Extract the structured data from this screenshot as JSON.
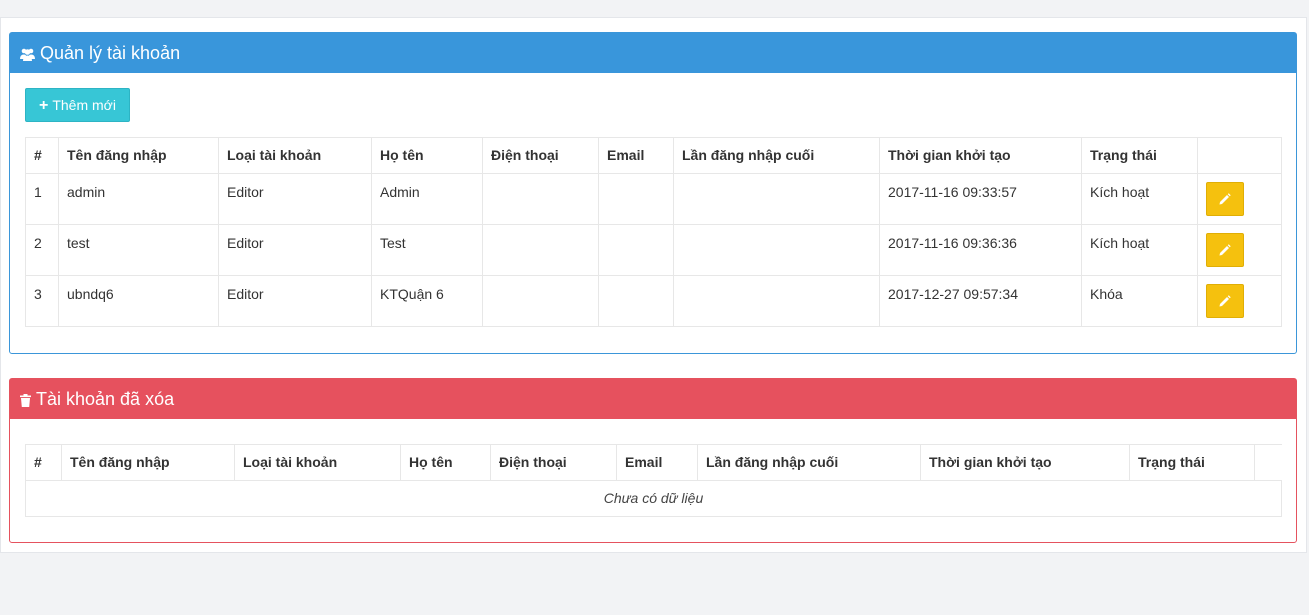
{
  "colors": {
    "primary": "#3996db",
    "danger": "#e6515e",
    "info": "#37c6d6",
    "warning": "#f5c10e"
  },
  "accounts_panel": {
    "title": "Quản lý tài khoản",
    "icon": "users-icon",
    "add_button_label": "Thêm mới",
    "columns": [
      "#",
      "Tên đăng nhập",
      "Loại tài khoản",
      "Họ tên",
      "Điện thoại",
      "Email",
      "Lần đăng nhập cuối",
      "Thời gian khởi tạo",
      "Trạng thái",
      ""
    ],
    "rows": [
      {
        "no": "1",
        "username": "admin",
        "type": "Editor",
        "fullname": "Admin",
        "phone": "",
        "email": "",
        "last_login": "",
        "created": "2017-11-16 09:33:57",
        "status": "Kích hoạt"
      },
      {
        "no": "2",
        "username": "test",
        "type": "Editor",
        "fullname": "Test",
        "phone": "",
        "email": "",
        "last_login": "",
        "created": "2017-11-16 09:36:36",
        "status": "Kích hoạt"
      },
      {
        "no": "3",
        "username": "ubndq6",
        "type": "Editor",
        "fullname": "KTQuận 6",
        "phone": "",
        "email": "",
        "last_login": "",
        "created": "2017-12-27 09:57:34",
        "status": "Khóa"
      }
    ]
  },
  "deleted_panel": {
    "title": "Tài khoản đã xóa",
    "icon": "trash-icon",
    "columns": [
      "#",
      "Tên đăng nhập",
      "Loại tài khoản",
      "Họ tên",
      "Điện thoại",
      "Email",
      "Lần đăng nhập cuối",
      "Thời gian khởi tạo",
      "Trạng thái"
    ],
    "empty_text": "Chưa có dữ liệu"
  }
}
